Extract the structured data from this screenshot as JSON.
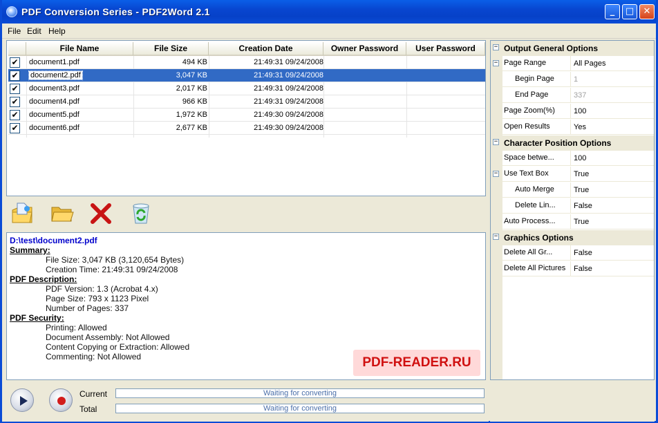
{
  "window": {
    "title": "PDF Conversion Series - PDF2Word 2.1"
  },
  "menu": [
    "File",
    "Edit",
    "Help"
  ],
  "table": {
    "columns": [
      "File Name",
      "File Size",
      "Creation Date",
      "Owner Password",
      "User Password"
    ],
    "rows": [
      {
        "name": "document1.pdf",
        "size": "494 KB",
        "date": "21:49:31 09/24/2008",
        "selected": false
      },
      {
        "name": "document2.pdf",
        "size": "3,047 KB",
        "date": "21:49:31 09/24/2008",
        "selected": true
      },
      {
        "name": "document3.pdf",
        "size": "2,017 KB",
        "date": "21:49:31 09/24/2008",
        "selected": false
      },
      {
        "name": "document4.pdf",
        "size": "966 KB",
        "date": "21:49:31 09/24/2008",
        "selected": false
      },
      {
        "name": "document5.pdf",
        "size": "1,972 KB",
        "date": "21:49:30 09/24/2008",
        "selected": false
      },
      {
        "name": "document6.pdf",
        "size": "2,677 KB",
        "date": "21:49:30 09/24/2008",
        "selected": false
      }
    ]
  },
  "toolbar": {
    "icons": [
      "add-file-icon",
      "open-folder-icon",
      "delete-icon",
      "clear-list-icon"
    ]
  },
  "info": {
    "path": "D:\\test\\document2.pdf",
    "summary_heading": "Summary:",
    "file_size": "File Size: 3,047 KB (3,120,654 Bytes)",
    "creation_time": "Creation Time: 21:49:31 09/24/2008",
    "description_heading": "PDF Description:",
    "pdf_version": "PDF Version: 1.3 (Acrobat 4.x)",
    "page_size": "Page Size: 793 x 1123 Pixel",
    "num_pages": "Number of Pages: 337",
    "security_heading": "PDF Security:",
    "printing": "Printing: Allowed",
    "assembly": "Document Assembly: Not Allowed",
    "copying": "Content Copying or Extraction: Allowed",
    "commenting": "Commenting: Not Allowed"
  },
  "watermark": "PDF-READER.RU",
  "status": {
    "current_label": "Current",
    "total_label": "Total",
    "current_text": "Waiting for converting",
    "total_text": "Waiting for converting"
  },
  "props": {
    "cat_output": "Output General Options",
    "page_range": {
      "k": "Page Range",
      "v": "All Pages"
    },
    "begin_page": {
      "k": "Begin Page",
      "v": "1"
    },
    "end_page": {
      "k": "End Page",
      "v": "337"
    },
    "page_zoom": {
      "k": "Page Zoom(%)",
      "v": "100"
    },
    "open_results": {
      "k": "Open Results",
      "v": "Yes"
    },
    "cat_char": "Character Position Options",
    "space_between": {
      "k": "Space betwe...",
      "v": "100"
    },
    "use_text_box": {
      "k": "Use Text Box",
      "v": "True"
    },
    "auto_merge": {
      "k": "Auto Merge",
      "v": "True"
    },
    "delete_lin": {
      "k": "Delete Lin...",
      "v": "False"
    },
    "auto_process": {
      "k": "Auto Process...",
      "v": "True"
    },
    "cat_graphics": "Graphics Options",
    "delete_all_gr": {
      "k": "Delete All Gr...",
      "v": "False"
    },
    "delete_all_pictures": {
      "k": "Delete All Pictures",
      "v": "False"
    }
  }
}
